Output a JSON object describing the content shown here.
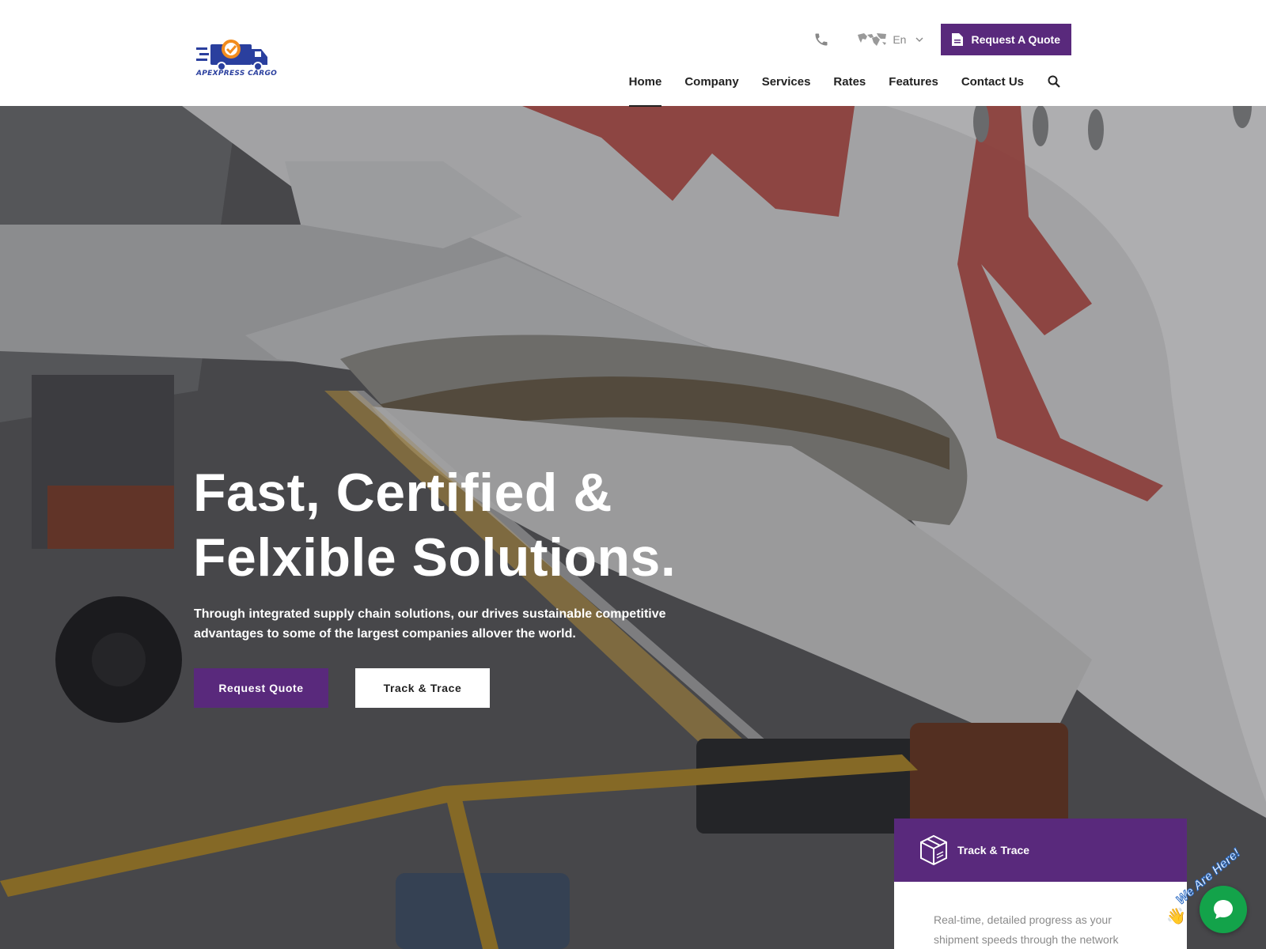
{
  "header": {
    "logo_text": "APEXPRESS CARGO",
    "language": "En",
    "quote_button": "Request A Quote",
    "nav": [
      "Home",
      "Company",
      "Services",
      "Rates",
      "Features",
      "Contact Us"
    ],
    "active_nav": "Home"
  },
  "hero": {
    "title_line1": "Fast, Certified &",
    "title_line2": "Felxible Solutions.",
    "subtitle": "Through integrated supply chain solutions, our drives sustainable competitive advantages to some of the largest companies allover the world.",
    "primary_button": "Request Quote",
    "secondary_button": "Track & Trace"
  },
  "track_card": {
    "title": "Track & Trace",
    "text": "Real-time, detailed progress as your shipment speeds through the network"
  },
  "chat": {
    "label": "We Are Here!"
  },
  "colors": {
    "brand": "#59297c",
    "chat": "#13a34a",
    "logo_blue": "#2a3f9e",
    "logo_orange": "#f28c1e"
  },
  "icons": [
    "phone-icon",
    "globe-icon",
    "chevron-down-icon",
    "document-icon",
    "search-icon",
    "box-icon",
    "chat-icon"
  ]
}
